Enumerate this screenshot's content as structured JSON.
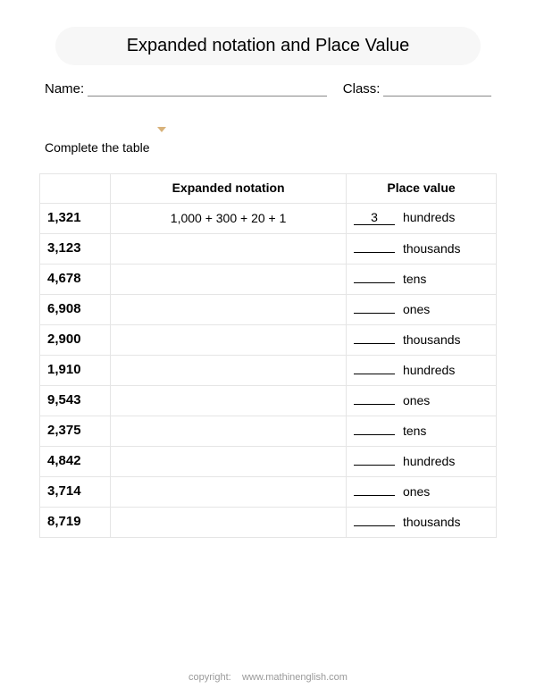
{
  "title": "Expanded notation and Place Value",
  "meta": {
    "name_label": "Name:",
    "class_label": "Class:"
  },
  "instruction": "Complete the table",
  "headers": {
    "number": "",
    "expanded": "Expanded notation",
    "place_value": "Place value"
  },
  "rows": [
    {
      "number": "1,321",
      "expanded": "1,000 + 300 + 20 + 1",
      "answer": "3",
      "unit": "hundreds"
    },
    {
      "number": "3,123",
      "expanded": "",
      "answer": "",
      "unit": "thousands"
    },
    {
      "number": "4,678",
      "expanded": "",
      "answer": "",
      "unit": "tens"
    },
    {
      "number": "6,908",
      "expanded": "",
      "answer": "",
      "unit": "ones"
    },
    {
      "number": "2,900",
      "expanded": "",
      "answer": "",
      "unit": "thousands"
    },
    {
      "number": "1,910",
      "expanded": "",
      "answer": "",
      "unit": "hundreds"
    },
    {
      "number": "9,543",
      "expanded": "",
      "answer": "",
      "unit": "ones"
    },
    {
      "number": "2,375",
      "expanded": "",
      "answer": "",
      "unit": "tens"
    },
    {
      "number": "4,842",
      "expanded": "",
      "answer": "",
      "unit": "hundreds"
    },
    {
      "number": "3,714",
      "expanded": "",
      "answer": "",
      "unit": "ones"
    },
    {
      "number": "8,719",
      "expanded": "",
      "answer": "",
      "unit": "thousands"
    }
  ],
  "footer": {
    "label": "copyright:",
    "site": "www.mathinenglish.com"
  }
}
